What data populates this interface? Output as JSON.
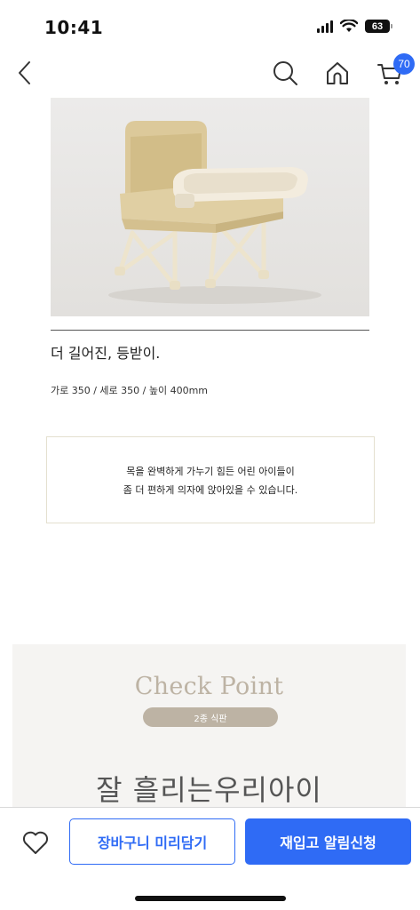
{
  "status_bar": {
    "time": "10:41",
    "battery": "63"
  },
  "nav": {
    "cart_badge": "70"
  },
  "product": {
    "headline": "더 길어진, 등받이.",
    "dimensions": "가로 350 / 세로 350 / 높이 400mm",
    "note_lines": [
      "목을 완벽하게 가누기 힘든 어린 아이들이",
      "좀 더 편하게 의자에 앉아있을 수 있습니다."
    ]
  },
  "checkpoint": {
    "title": "Check Point",
    "pill": "2종 식판",
    "subtitle": "잘 흘리는우리아이"
  },
  "bottom_bar": {
    "cart_label": "장바구니 미리담기",
    "restock_label": "재입고 알림신청"
  },
  "colors": {
    "accent": "#2f6bf5",
    "checkpoint_beige": "#bdb3a4",
    "note_border": "#e4e0cf"
  },
  "icons": [
    "chevron-left-icon",
    "search-icon",
    "home-icon",
    "cart-icon",
    "heart-icon",
    "signal-icon",
    "wifi-icon",
    "battery-icon"
  ]
}
